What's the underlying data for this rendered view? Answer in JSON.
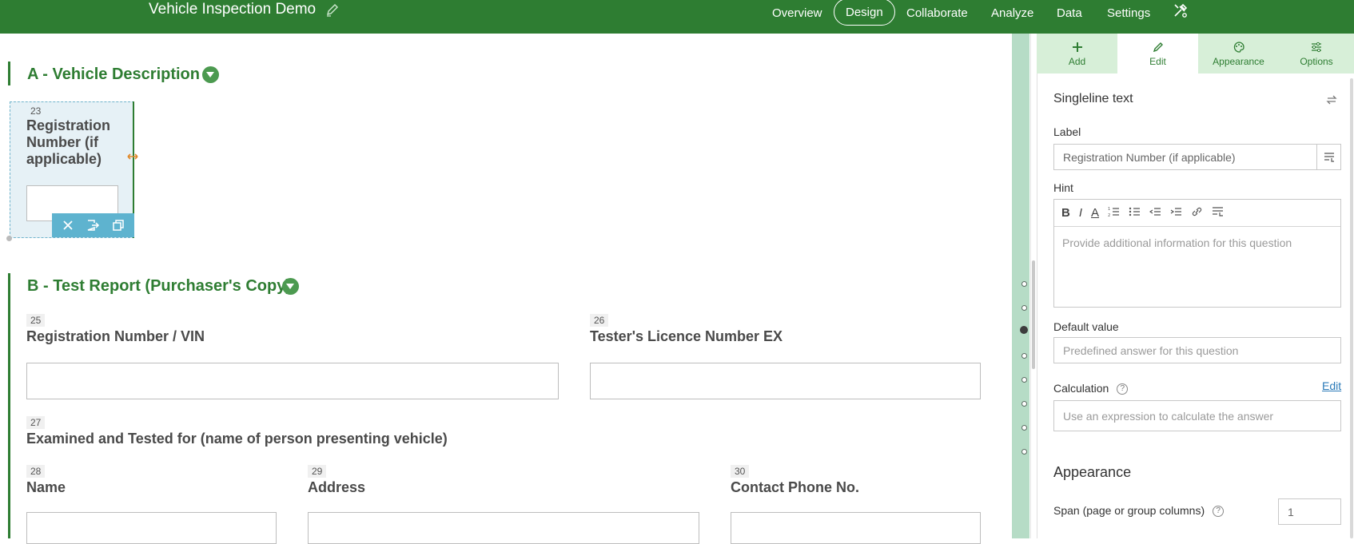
{
  "header": {
    "title": "Vehicle Inspection Demo",
    "nav": [
      "Overview",
      "Design",
      "Collaborate",
      "Analyze",
      "Data",
      "Settings"
    ],
    "active_nav": "Design"
  },
  "sections": [
    {
      "title": "A - Vehicle Description"
    },
    {
      "title": "B - Test Report (Purchaser's Copy)"
    }
  ],
  "questions": [
    {
      "num": "23",
      "label": "Registration Number (if applicable)"
    },
    {
      "num": "25",
      "label": "Registration Number / VIN"
    },
    {
      "num": "26",
      "label": "Tester's Licence Number EX"
    },
    {
      "num": "27",
      "label": "Examined and Tested for (name of person presenting vehicle)"
    },
    {
      "num": "28",
      "label": "Name"
    },
    {
      "num": "29",
      "label": "Address"
    },
    {
      "num": "30",
      "label": "Contact Phone No."
    }
  ],
  "panel": {
    "tabs": [
      "Add",
      "Edit",
      "Appearance",
      "Options"
    ],
    "active_tab": "Edit",
    "type_title": "Singleline text",
    "label_heading": "Label",
    "label_value": "Registration Number (if applicable)",
    "hint_heading": "Hint",
    "hint_placeholder": "Provide additional information for this question",
    "default_heading": "Default value",
    "default_placeholder": "Predefined answer for this question",
    "calc_heading": "Calculation",
    "calc_edit": "Edit",
    "calc_placeholder": "Use an expression to calculate the answer",
    "appearance_heading": "Appearance",
    "span_label": "Span (page or group columns)",
    "span_value": "1"
  },
  "colors": {
    "brand_green": "#2e7d32",
    "selection_blue": "#5eb3cf",
    "tab_green": "#d7efd8"
  }
}
